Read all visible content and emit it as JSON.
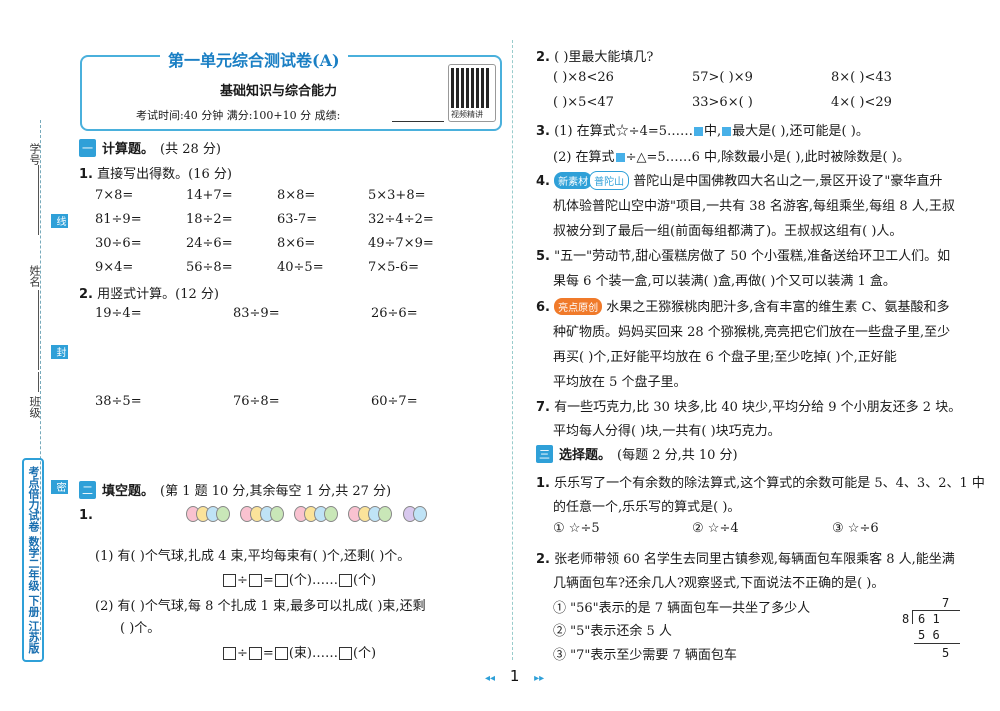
{
  "binding": {
    "xuehao": "学号",
    "xian": "线",
    "xingming": "姓名",
    "feng": "封",
    "banji": "班级",
    "mi": "密",
    "brand": "考点倍力试卷 数学二年级 下册 江苏版"
  },
  "header": {
    "title": "第一单元综合测试卷(A)",
    "subtitle": "基础知识与综合能力",
    "info": "考试时间:40 分钟    满分:100+10 分    成绩:",
    "qr_label": "视频精讲"
  },
  "sec1": {
    "num": "一",
    "name": "计算题。",
    "score": "(共 28 分)",
    "q1": "直接写出得数。(16 分)",
    "q1_items": [
      [
        "7×8=",
        "14+7=",
        "8×8=",
        "5×3+8="
      ],
      [
        "81÷9=",
        "18÷2=",
        "63-7=",
        "32÷4÷2="
      ],
      [
        "30÷6=",
        "24÷6=",
        "8×6=",
        "49÷7×9="
      ],
      [
        "9×4=",
        "56÷8=",
        "40÷5=",
        "7×5-6="
      ]
    ],
    "q2": "用竖式计算。(12 分)",
    "q2_items": [
      [
        "19÷4=",
        "83÷9=",
        "26÷6="
      ],
      [
        "38÷5=",
        "76÷8=",
        "60÷7="
      ]
    ]
  },
  "sec2": {
    "num": "二",
    "name": "填空题。",
    "score": "(第 1 题 10 分,其余每空 1 分,共 27 分)",
    "q1_num": "1.",
    "q1a": "(1) 有(    )个气球,扎成 4 束,平均每束有(    )个,还剩(    )个。",
    "q1a_unit": "(个)",
    "q1b_1": "(2) 有(    )个气球,每 8 个扎成 1 束,最多可以扎成(    )束,还剩",
    "q1b_2": "(    )个。",
    "q1b_unit": "(束)",
    "q1b_unit2": "(个)"
  },
  "right": {
    "q2": "(    )里最大能填几?",
    "q2_items": [
      [
        "(    )×8<26",
        "57>(    )×9",
        "8×(    )<43"
      ],
      [
        "(    )×5<47",
        "33>6×(    )",
        "4×(    )<29"
      ]
    ],
    "q3a": "(1) 在算式☆÷4=5……",
    "q3a_2": "中,",
    "q3a_3": "最大是(    ),还可能是(    )。",
    "q3b": "(2) 在算式",
    "q3b_2": "÷△=5……6 中,除数最小是(    ),此时被除数是(    )。",
    "q4_tag1": "新素材",
    "q4_tag2": "普陀山",
    "q4_1": "普陀山是中国佛教四大名山之一,景区开设了\"豪华直升",
    "q4_2": "机体验普陀山空中游\"项目,一共有 38 名游客,每组乘坐,每组 8 人,王叔",
    "q4_3": "叔被分到了最后一组(前面每组都满了)。王叔叔这组有(    )人。",
    "q5_1": "\"五一\"劳动节,甜心蛋糕房做了 50 个小蛋糕,准备送给环卫工人们。如",
    "q5_2": "果每 6 个装一盒,可以装满(    )盒,再做(    )个又可以装满 1 盒。",
    "q6_tag": "亮点原创",
    "q6_1": "水果之王猕猴桃肉肥汁多,含有丰富的维生素 C、氨基酸和多",
    "q6_2": "种矿物质。妈妈买回来 28 个猕猴桃,亮亮把它们放在一些盘子里,至少",
    "q6_3": "再买(    )个,正好能平均放在 6 个盘子里;至少吃掉(    )个,正好能",
    "q6_4": "平均放在 5 个盘子里。",
    "q7_1": "有一些巧克力,比 30 块多,比 40 块少,平均分给 9 个小朋友还多 2 块。",
    "q7_2": "平均每人分得(    )块,一共有(    )块巧克力。",
    "sec3_num": "三",
    "sec3_name": "选择题。",
    "sec3_score": "(每题 2 分,共 10 分)",
    "c1_1": "乐乐写了一个有余数的除法算式,这个算式的余数可能是 5、4、3、2、1 中",
    "c1_2": "的任意一个,乐乐写的算式是(    )。",
    "c1_opts": [
      "① ☆÷5",
      "② ☆÷4",
      "③ ☆÷6"
    ],
    "c2_1": "张老师带领 60 名学生去同里古镇参观,每辆面包车限乘客 8 人,能坐满",
    "c2_2": "几辆面包车?还余几人?观察竖式,下面说法不正确的是(    )。",
    "c2_opts": [
      "① \"56\"表示的是 7 辆面包车一共坐了多少人",
      "② \"5\"表示还余 5 人",
      "③ \"7\"表示至少需要 7 辆面包车"
    ],
    "longdiv": {
      "quotient": "7",
      "divisor": "8",
      "dividend": "6 1",
      "product": "5 6",
      "remainder": "5"
    }
  },
  "nums": {
    "r2": "2.",
    "r3": "3.",
    "r4": "4.",
    "r5": "5.",
    "r6": "6.",
    "r7": "7.",
    "c1": "1.",
    "c2": "2.",
    "l1": "1.",
    "l2": "2."
  },
  "page": {
    "number": "1",
    "prev": "◂◂",
    "next": "▸▸"
  }
}
